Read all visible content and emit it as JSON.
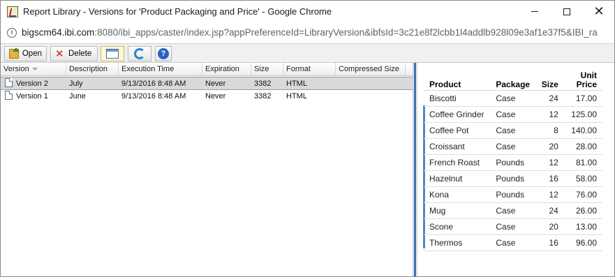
{
  "window": {
    "title": "Report Library - Versions for 'Product Packaging and Price' - Google Chrome",
    "controls": {
      "minimize": "—",
      "maximize": "☐",
      "close": "✕"
    }
  },
  "address": {
    "host": "bigscm64.ibi.com",
    "rest": ":8080/ibi_apps/caster/index.jsp?appPreferenceId=LibraryVersion&ibfsId=3c21e8f2lcbb1l4addlb928l09e3af1e37f5&IBI_ra"
  },
  "toolbar": {
    "open_label": "Open",
    "delete_label": "Delete"
  },
  "grid": {
    "columns": [
      "Version",
      "Description",
      "Execution Time",
      "Expiration",
      "Size",
      "Format",
      "Compressed Size"
    ],
    "rows": [
      {
        "version": "Version 2",
        "description": "July",
        "execution_time": "9/13/2016 8:48 AM",
        "expiration": "Never",
        "size": "3382",
        "format": "HTML",
        "compressed_size": ""
      },
      {
        "version": "Version 1",
        "description": "June",
        "execution_time": "9/13/2016 8:48 AM",
        "expiration": "Never",
        "size": "3382",
        "format": "HTML",
        "compressed_size": ""
      }
    ],
    "selected_row": 0
  },
  "report": {
    "headers": {
      "product": "Product",
      "package": "Package",
      "size": "Size",
      "unit_price_line1": "Unit",
      "unit_price_line2": "Price"
    },
    "rows": [
      {
        "product": "Biscotti",
        "package": "Case",
        "size": "24",
        "price": "17.00"
      },
      {
        "product": "Coffee Grinder",
        "package": "Case",
        "size": "12",
        "price": "125.00"
      },
      {
        "product": "Coffee Pot",
        "package": "Case",
        "size": "8",
        "price": "140.00"
      },
      {
        "product": "Croissant",
        "package": "Case",
        "size": "20",
        "price": "28.00"
      },
      {
        "product": "French Roast",
        "package": "Pounds",
        "size": "12",
        "price": "81.00"
      },
      {
        "product": "Hazelnut",
        "package": "Pounds",
        "size": "16",
        "price": "58.00"
      },
      {
        "product": "Kona",
        "package": "Pounds",
        "size": "12",
        "price": "76.00"
      },
      {
        "product": "Mug",
        "package": "Case",
        "size": "24",
        "price": "26.00"
      },
      {
        "product": "Scone",
        "package": "Case",
        "size": "20",
        "price": "13.00"
      },
      {
        "product": "Thermos",
        "package": "Case",
        "size": "16",
        "price": "96.00"
      }
    ]
  },
  "colors": {
    "accent": "#3a6fb8",
    "selection": "#d9d9d9",
    "delete_red": "#d0211a"
  }
}
